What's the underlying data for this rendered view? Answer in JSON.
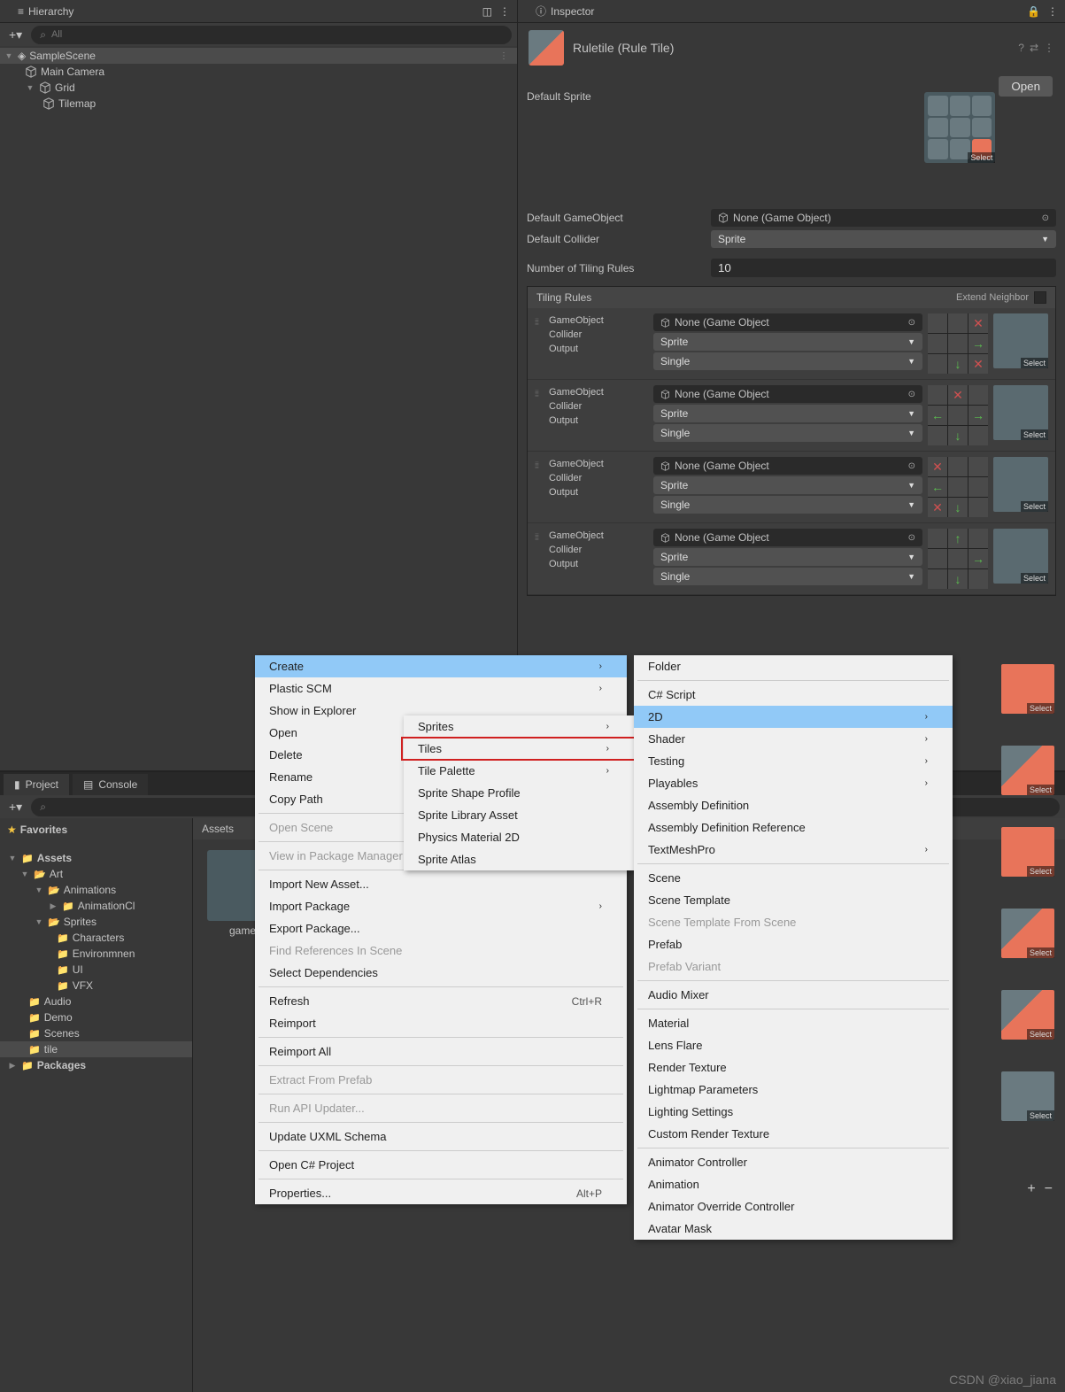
{
  "hierarchy": {
    "title": "Hierarchy",
    "search_placeholder": "All",
    "scene": "SampleScene",
    "items": [
      "Main Camera",
      "Grid",
      "Tilemap"
    ]
  },
  "inspector": {
    "title": "Inspector",
    "asset_name": "Ruletile (Rule Tile)",
    "open_btn": "Open",
    "default_sprite_label": "Default Sprite",
    "select_label": "Select",
    "default_go_label": "Default GameObject",
    "default_go_value": "None (Game Object)",
    "default_collider_label": "Default Collider",
    "default_collider_value": "Sprite",
    "num_rules_label": "Number of Tiling Rules",
    "num_rules_value": "10",
    "tiling_rules_label": "Tiling Rules",
    "extend_label": "Extend Neighbor",
    "rule": {
      "go_label": "GameObject",
      "go_value": "None (Game Object",
      "collider_label": "Collider",
      "collider_value": "Sprite",
      "output_label": "Output",
      "output_value": "Single"
    }
  },
  "project": {
    "tab1": "Project",
    "tab2": "Console",
    "favorites": "Favorites",
    "assets_root": "Assets",
    "breadcrumb": "Assets",
    "folders": [
      "Art",
      "Animations",
      "AnimationCl",
      "Sprites",
      "Characters",
      "Environmnen",
      "UI",
      "VFX",
      "Audio",
      "Demo",
      "Scenes",
      "tile"
    ],
    "packages": "Packages",
    "grid_item": "game"
  },
  "menu1": {
    "items": [
      "Create",
      "Plastic SCM",
      "Show in Explorer",
      "Open",
      "Delete",
      "Rename",
      "Copy Path",
      "Open Scene",
      "View in Package Manager",
      "Import New Asset...",
      "Import Package",
      "Export Package...",
      "Find References In Scene",
      "Select Dependencies",
      "Refresh",
      "Reimport",
      "Reimport All",
      "Extract From Prefab",
      "Run API Updater...",
      "Update UXML Schema",
      "Open C# Project",
      "Properties..."
    ],
    "shortcut_refresh": "Ctrl+R",
    "shortcut_props": "Alt+P"
  },
  "menu2": {
    "items": [
      "Sprites",
      "Tiles",
      "Tile Palette",
      "Sprite Shape Profile",
      "Sprite Library Asset",
      "Physics Material 2D",
      "Sprite Atlas"
    ]
  },
  "menu3": {
    "items": [
      "Folder",
      "C# Script",
      "2D",
      "Shader",
      "Testing",
      "Playables",
      "Assembly Definition",
      "Assembly Definition Reference",
      "TextMeshPro",
      "Scene",
      "Scene Template",
      "Scene Template From Scene",
      "Prefab",
      "Prefab Variant",
      "Audio Mixer",
      "Material",
      "Lens Flare",
      "Render Texture",
      "Lightmap Parameters",
      "Lighting Settings",
      "Custom Render Texture",
      "Animator Controller",
      "Animation",
      "Animator Override Controller",
      "Avatar Mask"
    ]
  },
  "watermark": "CSDN @xiao_jiana"
}
